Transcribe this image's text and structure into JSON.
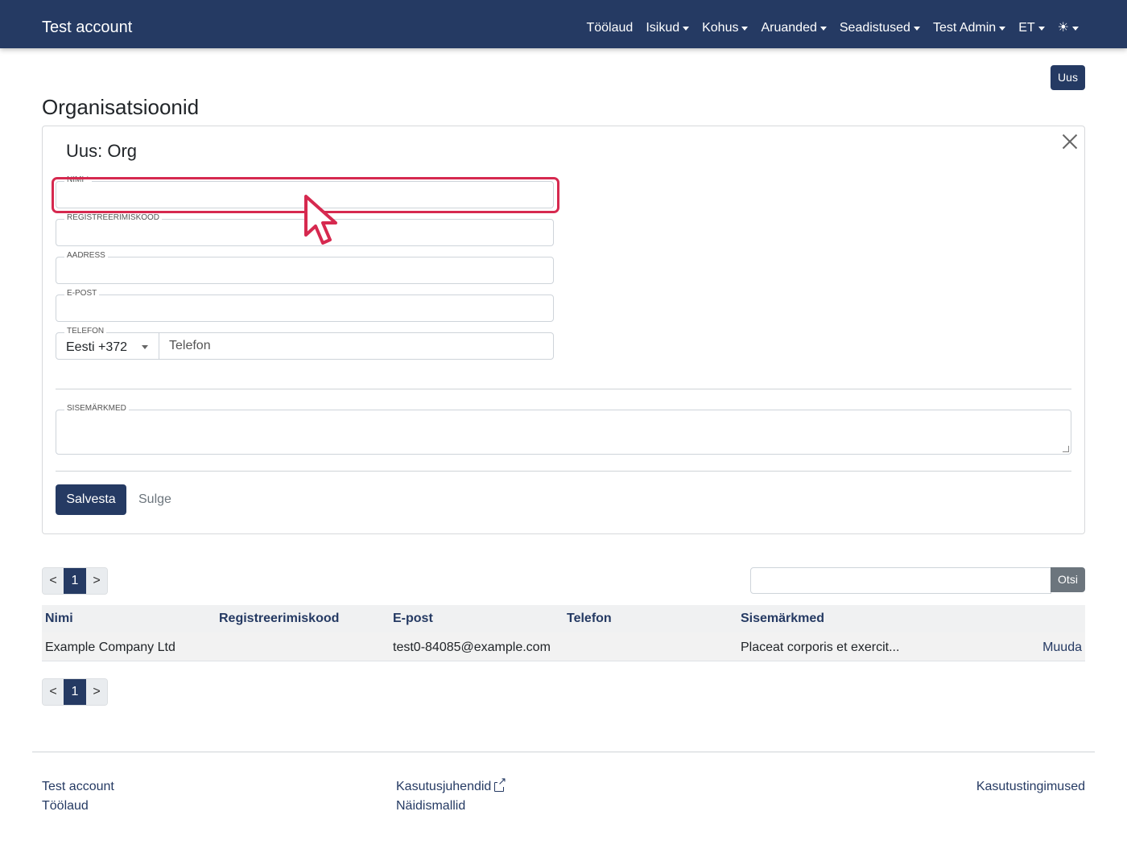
{
  "navbar": {
    "brand": "Test account",
    "items": [
      {
        "label": "Töölaud",
        "dropdown": false
      },
      {
        "label": "Isikud",
        "dropdown": true
      },
      {
        "label": "Kohus",
        "dropdown": true
      },
      {
        "label": "Aruanded",
        "dropdown": true
      },
      {
        "label": "Seadistused",
        "dropdown": true
      },
      {
        "label": "Test Admin",
        "dropdown": true
      },
      {
        "label": "ET",
        "dropdown": true
      }
    ],
    "theme_icon": "☀"
  },
  "new_button": "Uus",
  "page_title": "Organisatsioonid",
  "form": {
    "title": "Uus: Org",
    "fields": {
      "nimi": {
        "label": "NIMI",
        "required_mark": "*",
        "value": ""
      },
      "registreerimiskood": {
        "label": "REGISTREERIMISKOOD",
        "value": ""
      },
      "aadress": {
        "label": "AADRESS",
        "value": ""
      },
      "epost": {
        "label": "E-POST",
        "value": ""
      },
      "telefon": {
        "label": "TELEFON",
        "country": "Eesti +372",
        "placeholder": "Telefon",
        "value": ""
      },
      "sisemarkmed": {
        "label": "SISEMÄRKMED",
        "value": ""
      }
    },
    "save_label": "Salvesta",
    "close_label": "Sulge"
  },
  "pagination": {
    "prev": "<",
    "current": "1",
    "next": ">"
  },
  "search": {
    "value": "",
    "button_label": "Otsi"
  },
  "table": {
    "headers": [
      "Nimi",
      "Registreerimiskood",
      "E-post",
      "Telefon",
      "Sisemärkmed"
    ],
    "rows": [
      {
        "nimi": "Example Company Ltd",
        "registreerimiskood": "",
        "epost": "test0-84085@example.com",
        "telefon": "",
        "sisemarkmed": "Placeat corporis et exercit...",
        "action": "Muuda"
      }
    ]
  },
  "footer": {
    "col1": [
      "Test account",
      "Töölaud"
    ],
    "col2": [
      "Kasutusjuhendid",
      "Näidismallid"
    ],
    "col3": [
      "Kasutustingimused"
    ]
  },
  "colors": {
    "primary": "#253a63",
    "highlight": "#d6294f",
    "secondary": "#6c757d"
  }
}
